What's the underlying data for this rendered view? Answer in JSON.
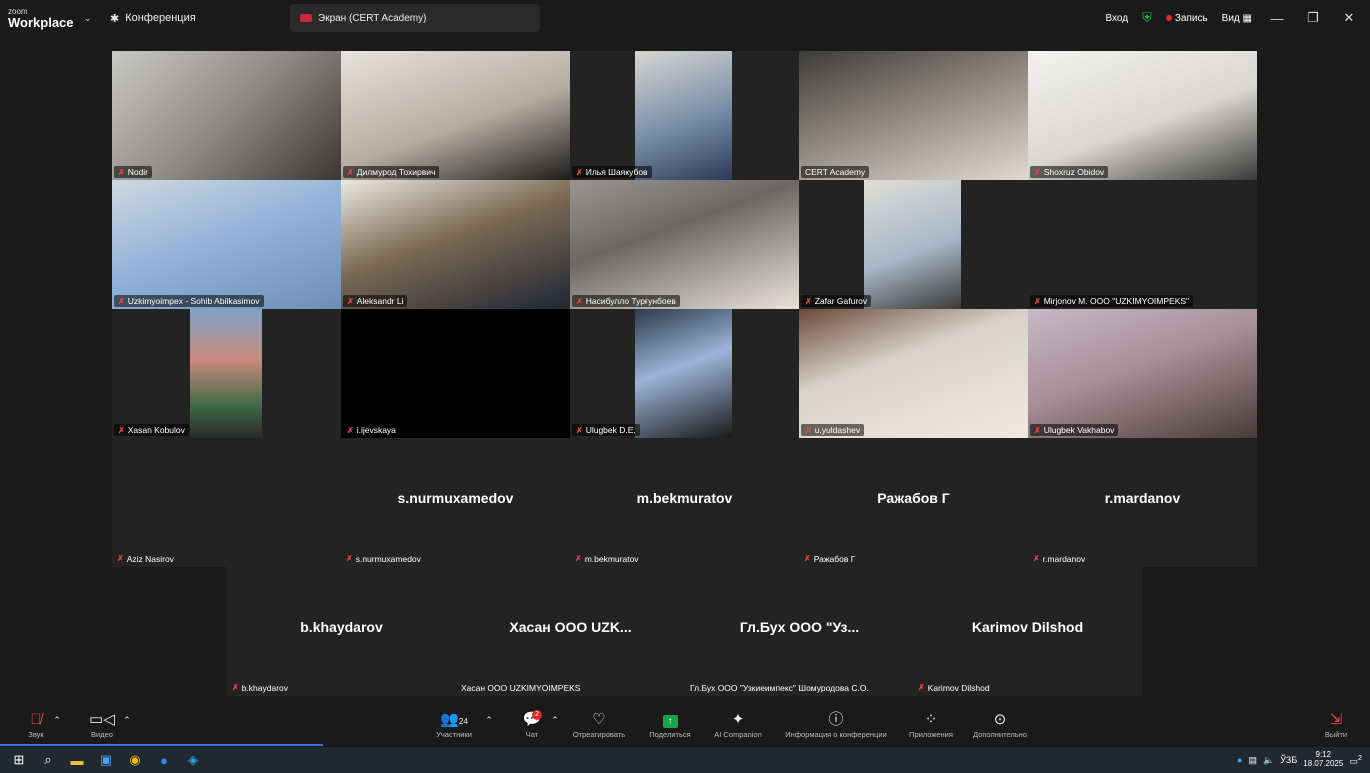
{
  "titlebar": {
    "logo_small": "zoom",
    "logo_big": "Workplace",
    "meeting_tab": "Конференция",
    "screen_tab": "Экран (CERT Academy)",
    "login": "Вход",
    "record": "Запись",
    "view": "Вид"
  },
  "tiles": [
    {
      "name": "Nodir",
      "mic_off": true
    },
    {
      "name": "Дилмурод Тохирвич",
      "mic_off": true
    },
    {
      "name": "Илья Шаякубов",
      "mic_off": true
    },
    {
      "name": "CERT Academy",
      "mic_off": false,
      "active": true
    },
    {
      "name": "Shoxruz Obidov",
      "mic_off": true
    },
    {
      "name": "Uzkimyoimpex - Sohib Abilkasimov",
      "mic_off": true
    },
    {
      "name": "Aleksandr Li",
      "mic_off": true
    },
    {
      "name": "Насибулло Турғунбоев",
      "mic_off": true
    },
    {
      "name": "Zafar Gafurov",
      "mic_off": true
    },
    {
      "name": "Mirjonov M. OOO \"UZKIMYOIMPEKS\"",
      "mic_off": true
    },
    {
      "name": "Xasan Kobulov",
      "mic_off": true
    },
    {
      "name": "i.ijevskaya",
      "mic_off": true
    },
    {
      "name": "Ulugbek D.E.",
      "mic_off": true
    },
    {
      "name": "u.yuldashev",
      "mic_off": true
    },
    {
      "name": "Ulugbek Vakhabov",
      "mic_off": true
    }
  ],
  "name_tiles_row4": [
    {
      "big": "",
      "name": "Aziz Nasirov",
      "mic_off": true
    },
    {
      "big": "s.nurmuxamedov",
      "name": "s.nurmuxamedov",
      "mic_off": true
    },
    {
      "big": "m.bekmuratov",
      "name": "m.bekmuratov",
      "mic_off": true
    },
    {
      "big": "Ражабов Г",
      "name": "Ражабов Г",
      "mic_off": true
    },
    {
      "big": "r.mardanov",
      "name": "r.mardanov",
      "mic_off": true
    }
  ],
  "name_tiles_row5": [
    {
      "big": "b.khaydarov",
      "name": "b.khaydarov",
      "mic_off": true
    },
    {
      "big": "Хасан ООО UZK...",
      "name": "Хасан ООО UZKIMYOIMPEKS",
      "mic_off": false
    },
    {
      "big": "Гл.Бух ООО \"Уз...",
      "name": "Гл.Бух ООО \"Узкиеимпекс\" Шомуродова С.О.",
      "mic_off": false
    },
    {
      "big": "Karimov Dilshod",
      "name": "Karimov Dilshod",
      "mic_off": true
    }
  ],
  "toolbar": {
    "audio": "Звук",
    "video": "Видео",
    "participants": "Участники",
    "participants_count": "24",
    "chat": "Чат",
    "chat_badge": "2",
    "react": "Отреагировать",
    "share": "Поделиться",
    "ai": "AI Companion",
    "info": "Информация о конференции",
    "apps": "Приложения",
    "more": "Дополнительно",
    "leave": "Выйти"
  },
  "taskbar": {
    "lang": "ЎЗБ",
    "time": "9:12",
    "date": "18.07.2025",
    "notif": "2"
  },
  "colors": {
    "accent_green": "#23c44a",
    "mic_off_red": "#e84545",
    "share_green": "#16a34a"
  }
}
